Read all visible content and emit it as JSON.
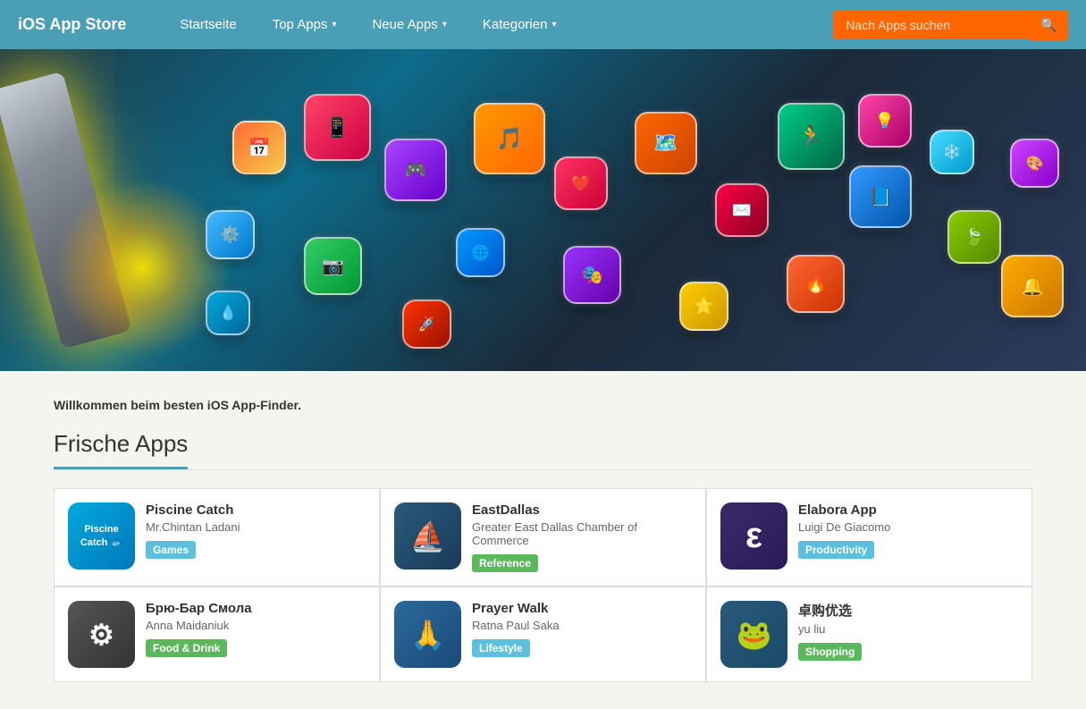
{
  "brand": "iOS App Store",
  "nav": {
    "startseite": "Startseite",
    "top_apps": "Top Apps",
    "neue_apps": "Neue Apps",
    "kategorien": "Kategorien"
  },
  "search": {
    "placeholder": "Nach Apps suchen",
    "icon": "🔍"
  },
  "welcome": "Willkommen beim besten iOS App-Finder.",
  "section": {
    "title": "Frische Apps"
  },
  "apps": [
    {
      "name": "Piscine Catch",
      "author": "Mr.Chintan Ladani",
      "category": "Games",
      "cat_class": "cat-games",
      "icon_class": "icon-piscine",
      "icon_text": "Piscine\nCatch 🐟",
      "description": ""
    },
    {
      "name": "EastDallas",
      "author": "Greater East Dallas Chamber of Commerce",
      "category": "Reference",
      "cat_class": "cat-reference",
      "icon_class": "icon-eastdallas",
      "icon_text": "⛵",
      "description": ""
    },
    {
      "name": "Elabora App",
      "author": "Luigi De Giacomo",
      "category": "Productivity",
      "cat_class": "cat-productivity",
      "icon_class": "icon-elabora",
      "icon_text": "ε",
      "description": ""
    },
    {
      "name": "Брю-Бар Смола",
      "author": "Anna Maidaniuk",
      "category": "Food & Drink",
      "cat_class": "cat-food",
      "icon_class": "icon-bryu",
      "icon_text": "⚙",
      "description": ""
    },
    {
      "name": "Prayer Walk",
      "author": "Ratna Paul Saka",
      "category": "Lifestyle",
      "cat_class": "cat-lifestyle",
      "icon_class": "icon-prayer",
      "icon_text": "🙏",
      "description": ""
    },
    {
      "name": "卓购优选",
      "author": "yu liu",
      "category": "Shopping",
      "cat_class": "cat-shopping",
      "icon_class": "icon-zhuogou",
      "icon_text": "🐸",
      "description": ""
    }
  ],
  "icons": {
    "caret": "▾",
    "search": "🔍"
  }
}
